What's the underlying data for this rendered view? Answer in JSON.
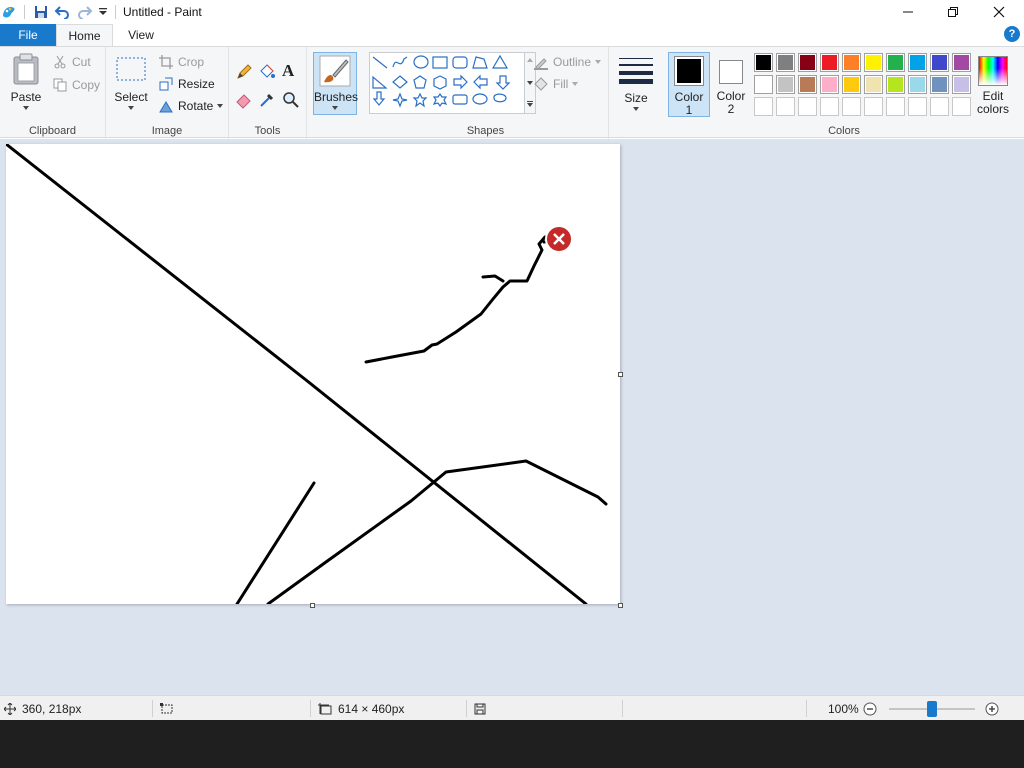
{
  "window": {
    "title": "Untitled - Paint"
  },
  "quick_access": {
    "icons": [
      "paint-app-icon",
      "save-icon",
      "undo-icon",
      "redo-icon",
      "customize-qat-icon"
    ]
  },
  "window_controls": [
    "minimize",
    "maximize",
    "close"
  ],
  "tabs": [
    {
      "label": "File",
      "active": false
    },
    {
      "label": "Home",
      "active": true
    },
    {
      "label": "View",
      "active": false
    }
  ],
  "help_label": "?",
  "ribbon": {
    "clipboard": {
      "label": "Clipboard",
      "paste": "Paste",
      "cut": "Cut",
      "copy": "Copy"
    },
    "image": {
      "label": "Image",
      "select": "Select",
      "crop": "Crop",
      "resize": "Resize",
      "rotate": "Rotate"
    },
    "tools": {
      "label": "Tools",
      "items": [
        "pencil",
        "fill",
        "text",
        "eraser",
        "color-picker",
        "magnifier"
      ]
    },
    "brushes": {
      "label": "Brushes"
    },
    "shapes": {
      "label": "Shapes",
      "outline": "Outline",
      "fill": "Fill"
    },
    "size": {
      "label": "Size"
    },
    "colors": {
      "label": "Colors",
      "color1": "Color\n1",
      "color1_line1": "Color",
      "color1_line2": "1",
      "color2_line1": "Color",
      "color2_line2": "2",
      "color1_value": "#000000",
      "color2_value": "#ffffff",
      "edit_line1": "Edit",
      "edit_line2": "colors",
      "palette_row1": [
        "#000000",
        "#7f7f7f",
        "#880015",
        "#ed1c24",
        "#ff7f27",
        "#fff200",
        "#22b14c",
        "#00a2e8",
        "#3f48cc",
        "#a349a4"
      ],
      "palette_row2": [
        "#ffffff",
        "#c3c3c3",
        "#b97a57",
        "#ffaec9",
        "#ffc90e",
        "#efe4b0",
        "#b5e61d",
        "#99d9ea",
        "#7092be",
        "#c8bfe7"
      ],
      "palette_row3": [
        "#ffffff",
        "#ffffff",
        "#ffffff",
        "#ffffff",
        "#ffffff",
        "#ffffff",
        "#ffffff",
        "#ffffff",
        "#ffffff",
        "#ffffff"
      ]
    }
  },
  "statusbar": {
    "cursor_position": "360, 218px",
    "selection_size": "",
    "canvas_size": "614 × 460px",
    "zoom": "100%",
    "zoom_level_percent": 100
  },
  "colors": {
    "accent": "#1979ca",
    "workspace_bg": "#dbe3ef",
    "ribbon_bg": "#f5f6f7",
    "stroke": "#000000"
  }
}
